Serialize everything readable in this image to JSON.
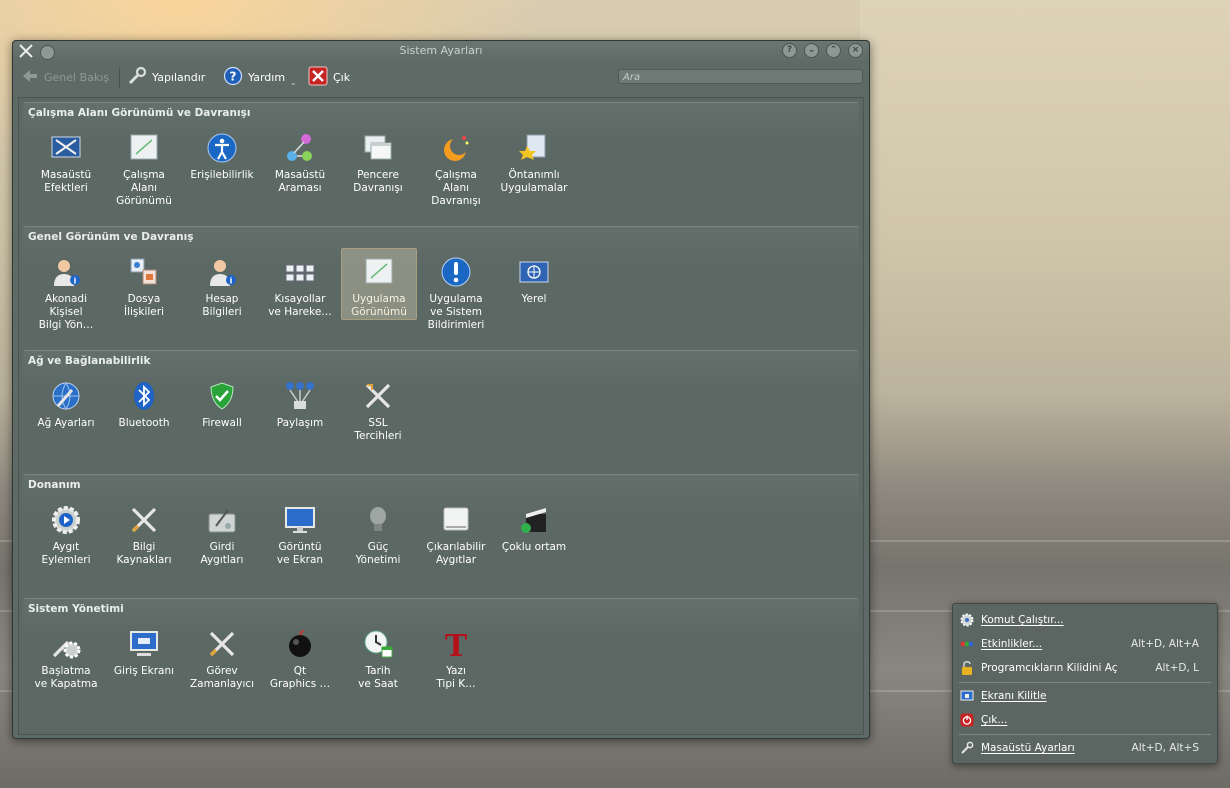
{
  "window": {
    "title": "Sistem Ayarları",
    "toolbar": {
      "overview": "Genel Bakış",
      "configure": "Yapılandır",
      "help": "Yardım",
      "quit": "Çık"
    },
    "search_placeholder": "Ara"
  },
  "sections": [
    {
      "title": "Çalışma Alanı Görünümü ve Davranışı",
      "items": [
        {
          "label": "Masaüstü\nEfektleri",
          "icon": "desktop-effects-icon"
        },
        {
          "label": "Çalışma\nAlanı\nGörünümü",
          "icon": "workspace-appearance-icon"
        },
        {
          "label": "Erişilebilirlik",
          "icon": "accessibility-icon"
        },
        {
          "label": "Masaüstü\nAraması",
          "icon": "desktop-search-icon"
        },
        {
          "label": "Pencere\nDavranışı",
          "icon": "window-behavior-icon"
        },
        {
          "label": "Çalışma\nAlanı\nDavranışı",
          "icon": "workspace-behavior-icon"
        },
        {
          "label": "Öntanımlı\nUygulamalar",
          "icon": "default-apps-icon"
        }
      ]
    },
    {
      "title": "Genel Görünüm ve Davranış",
      "items": [
        {
          "label": "Akonadi\nKişisel\nBilgi Yön…",
          "icon": "akonadi-icon"
        },
        {
          "label": "Dosya\nİlişkileri",
          "icon": "file-associations-icon"
        },
        {
          "label": "Hesap\nBilgileri",
          "icon": "account-details-icon"
        },
        {
          "label": "Kısayollar\nve Hareke…",
          "icon": "shortcuts-icon"
        },
        {
          "label": "Uygulama\nGörünümü",
          "icon": "application-appearance-icon"
        },
        {
          "label": "Uygulama\nve Sistem\nBildirimleri",
          "icon": "notifications-icon"
        },
        {
          "label": "Yerel",
          "icon": "locale-icon"
        }
      ]
    },
    {
      "title": "Ağ ve Bağlanabilirlik",
      "items": [
        {
          "label": "Ağ Ayarları",
          "icon": "network-settings-icon"
        },
        {
          "label": "Bluetooth",
          "icon": "bluetooth-icon"
        },
        {
          "label": "Firewall",
          "icon": "firewall-icon"
        },
        {
          "label": "Paylaşım",
          "icon": "sharing-icon"
        },
        {
          "label": "SSL\nTercihleri",
          "icon": "ssl-icon"
        }
      ]
    },
    {
      "title": "Donanım",
      "items": [
        {
          "label": "Aygıt\nEylemleri",
          "icon": "device-actions-icon"
        },
        {
          "label": "Bilgi\nKaynakları",
          "icon": "info-sources-icon"
        },
        {
          "label": "Girdi\nAygıtları",
          "icon": "input-devices-icon"
        },
        {
          "label": "Görüntü\nve Ekran",
          "icon": "display-icon"
        },
        {
          "label": "Güç\nYönetimi",
          "icon": "power-management-icon"
        },
        {
          "label": "Çıkarılabilir\nAygıtlar",
          "icon": "removable-devices-icon"
        },
        {
          "label": "Çoklu ortam",
          "icon": "multimedia-icon"
        }
      ]
    },
    {
      "title": "Sistem Yönetimi",
      "items": [
        {
          "label": "Başlatma\nve Kapatma",
          "icon": "startup-shutdown-icon"
        },
        {
          "label": "Giriş Ekranı",
          "icon": "login-screen-icon"
        },
        {
          "label": "Görev\nZamanlayıcı",
          "icon": "task-scheduler-icon"
        },
        {
          "label": "Qt\nGraphics …",
          "icon": "qt-graphics-icon"
        },
        {
          "label": "Tarih\nve Saat",
          "icon": "date-time-icon"
        },
        {
          "label": "Yazı\nTipi K…",
          "icon": "font-installer-icon"
        }
      ]
    }
  ],
  "context_menu": {
    "items": [
      {
        "label": "Komut Çalıştır...",
        "shortcut": "",
        "icon": "run-command-icon"
      },
      {
        "label": "Etkinlikler...",
        "shortcut": "Alt+D, Alt+A",
        "icon": "activities-icon"
      },
      {
        "label": "Programcıkların Kilidini Aç",
        "shortcut": "Alt+D, L",
        "icon": "unlock-icon"
      },
      {
        "label": "Ekranı Kilitle",
        "shortcut": "",
        "icon": "lock-screen-icon"
      },
      {
        "label": "Çık...",
        "shortcut": "",
        "icon": "logout-icon"
      },
      {
        "label": "Masaüstü Ayarları",
        "shortcut": "Alt+D, Alt+S",
        "icon": "desktop-settings-icon"
      }
    ]
  }
}
